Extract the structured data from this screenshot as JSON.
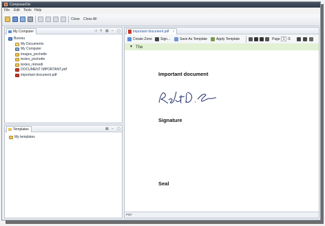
{
  "window": {
    "title": "ComposerDiv"
  },
  "menu": [
    "File",
    "Edit",
    "Tools",
    "Help"
  ],
  "toolbar": {
    "close_label": "Close",
    "close_all_label": "Close All"
  },
  "left_panel": {
    "tab": "My Computer",
    "tree": [
      {
        "label": "Bureau",
        "icon": "desktop-icon",
        "level": 0
      },
      {
        "label": "My Documents",
        "icon": "documents-folder-icon",
        "level": 1
      },
      {
        "label": "My Computer",
        "icon": "computer-icon",
        "level": 1
      },
      {
        "label": "images_pochette",
        "icon": "folder-icon",
        "level": 1
      },
      {
        "label": "textes_pochette",
        "icon": "folder-icon",
        "level": 1
      },
      {
        "label": "textes_rééxedi",
        "icon": "folder-icon",
        "level": 1
      },
      {
        "label": "DOCUMENT IMPORTANT.pdf",
        "icon": "pdf-file-icon",
        "level": 1
      },
      {
        "label": "important document.pdf",
        "icon": "pdf-file-icon",
        "level": 1
      }
    ]
  },
  "templates_panel": {
    "tab": "Templates",
    "tree": [
      {
        "label": "My templates",
        "icon": "folder-icon"
      }
    ]
  },
  "editor": {
    "tab": "important document.pdf",
    "tab_close": "☓",
    "toolbar": {
      "create_zone": "Create Zone",
      "sign": "Sign...",
      "save_as_template": "Save As Template",
      "apply_template": "Apply Template",
      "page_label": "Page",
      "page_value": "1",
      "page_total": "/1"
    },
    "signed_notice": "The document is digitally signed.",
    "document": {
      "heading": "Important document",
      "signature_text": "Robert D. Signature",
      "signature_label": "Signature",
      "seal_label": "Seal"
    },
    "status": "PDF"
  },
  "colors": {
    "title_bar": "#2f3a48",
    "signed_notice_bg": "#e2f0d4",
    "pdf_icon": "#c43b2a",
    "folder_icon": "#e9c25a"
  }
}
